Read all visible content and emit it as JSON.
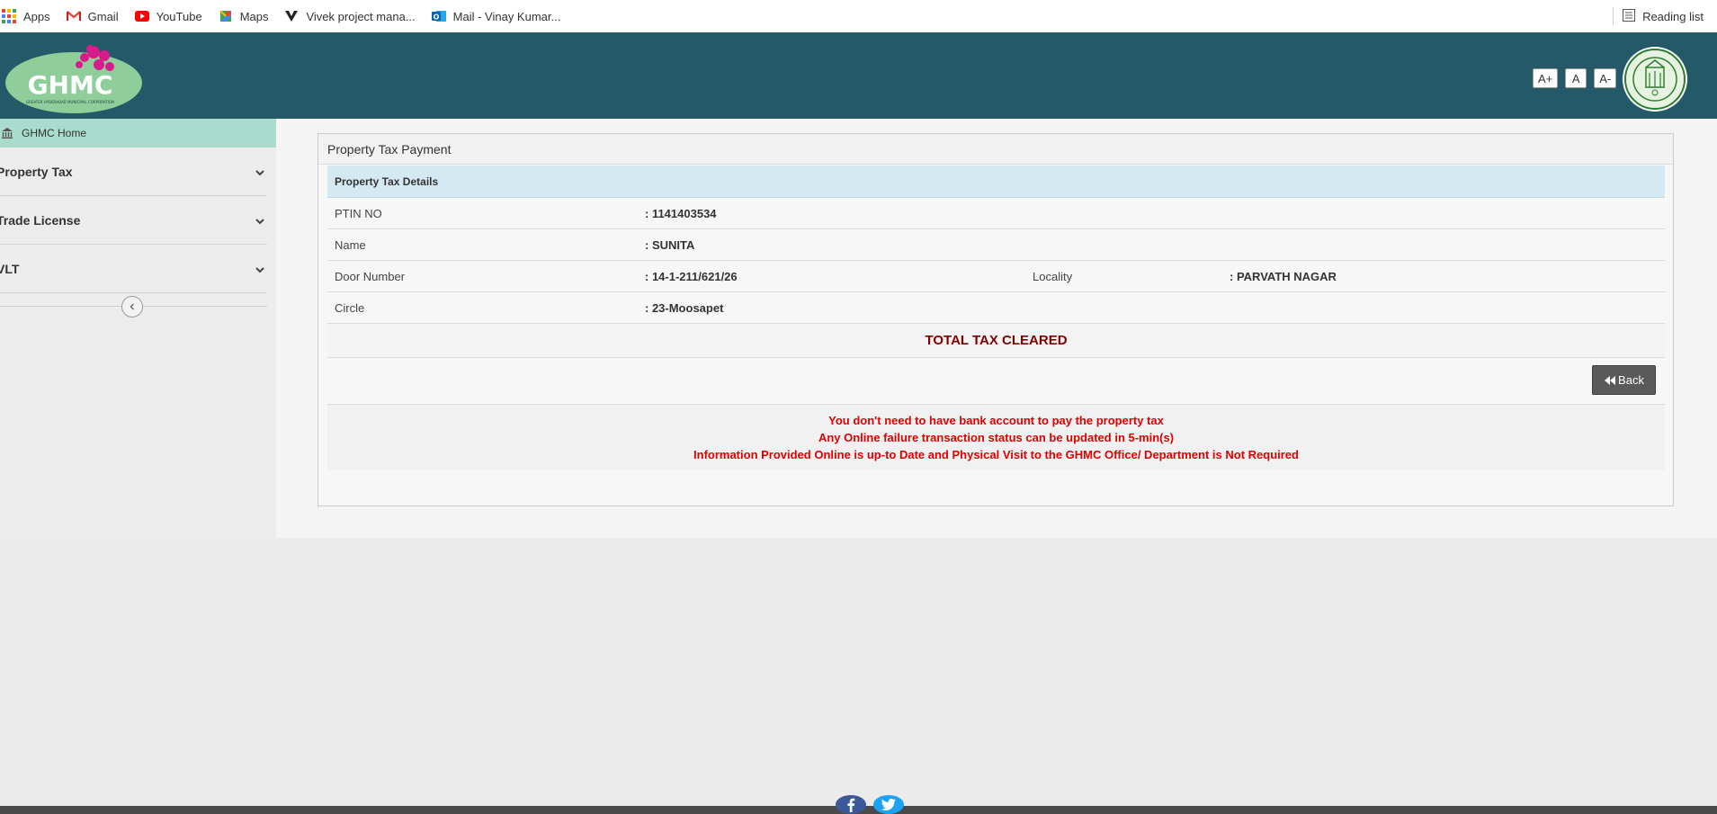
{
  "bookmarks": {
    "items": [
      {
        "label": "Apps",
        "icon": "apps-grid-icon"
      },
      {
        "label": "Gmail",
        "icon": "gmail-icon"
      },
      {
        "label": "YouTube",
        "icon": "youtube-icon"
      },
      {
        "label": "Maps",
        "icon": "maps-icon"
      },
      {
        "label": "Vivek project mana...",
        "icon": "vivek-icon"
      },
      {
        "label": "Mail - Vinay Kumar...",
        "icon": "outlook-icon"
      }
    ],
    "reading_list": "Reading list"
  },
  "header": {
    "logo_text": "GHMC",
    "logo_subtext": "GREATER HYDERABAD MUNICIPAL CORPORATION",
    "font_buttons": [
      "A+",
      "A",
      "A-"
    ],
    "colors": {
      "header_bg": "#245a67",
      "accent": "#a9dccd"
    }
  },
  "sidebar": {
    "home": "GHMC Home",
    "items": [
      {
        "label": "Property Tax"
      },
      {
        "label": "Trade License"
      },
      {
        "label": "VLT"
      }
    ]
  },
  "panel": {
    "title": "Property Tax Payment",
    "details_title": "Property Tax Details",
    "ptin_label": "PTIN NO",
    "ptin_value": ": 1141403534",
    "name_label": "Name",
    "name_value": ": SUNITA",
    "door_label": "Door Number",
    "door_value": ": 14-1-211/621/26",
    "locality_label": "Locality",
    "locality_value": ": PARVATH NAGAR",
    "circle_label": "Circle",
    "circle_value": ": 23-Moosapet",
    "status": "TOTAL TAX CLEARED",
    "back_label": "Back",
    "notices": [
      "You don't need to have bank account to pay the property tax",
      "Any Online failure transaction status can be updated in 5-min(s)",
      "Information Provided Online is up-to Date and Physical Visit to the GHMC Office/ Department is Not Required"
    ]
  }
}
